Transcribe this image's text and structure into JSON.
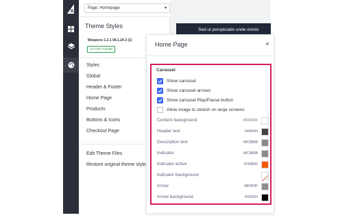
{
  "topbar": {
    "page_select_value": "Page: Homepage"
  },
  "sidebar": {
    "title": "Theme Styles",
    "theme_name": "Weapons 1.2.1 08.1.24-3 (1)",
    "active_badge": "ACTIVE THEME",
    "items": [
      {
        "label": "Styles"
      },
      {
        "label": "Global"
      },
      {
        "label": "Header & Footer"
      },
      {
        "label": "Home Page"
      },
      {
        "label": "Products"
      },
      {
        "label": "Buttons & Icons"
      },
      {
        "label": "Checkout Page"
      }
    ],
    "footer_items": [
      {
        "label": "Edit Theme Files"
      },
      {
        "label": "Restore original theme styles"
      }
    ]
  },
  "preview": {
    "banner_text": "Sed ut perspiciatis unde omnis"
  },
  "modal": {
    "title": "Home Page",
    "close_glyph": "×",
    "section_title": "Carousel",
    "checkboxes": [
      {
        "label": "Show carousel",
        "checked": true
      },
      {
        "label": "Show carousel arrows",
        "checked": true
      },
      {
        "label": "Show carousel Play/Pause button",
        "checked": true
      },
      {
        "label": "Allow image to stretch on large screens",
        "checked": false
      }
    ],
    "colors": [
      {
        "label": "Content background",
        "hex": "#FFFFFF",
        "swatch": "#ffffff"
      },
      {
        "label": "Header text",
        "hex": "#444444",
        "swatch": "#444444"
      },
      {
        "label": "Description text",
        "hex": "#8C8B8B",
        "swatch": "#8c8b8b"
      },
      {
        "label": "Indicator",
        "hex": "#8C8B8B",
        "swatch": "#8c8b8b"
      },
      {
        "label": "Indicator active",
        "hex": "#F55B06",
        "swatch": "#f55b06"
      },
      {
        "label": "Indicator background",
        "hex": "",
        "swatch": "transparent"
      },
      {
        "label": "Arrow",
        "hex": "#8F8F8F",
        "swatch": "#8f8f8f"
      },
      {
        "label": "Arrow background",
        "hex": "#000000",
        "swatch": "#000000"
      }
    ]
  },
  "colors": {
    "rail": "#2b2f3a",
    "accent_checkbox": "#3c64f4",
    "highlight_border": "#d41b5b",
    "badge_green": "#2e9d53"
  }
}
